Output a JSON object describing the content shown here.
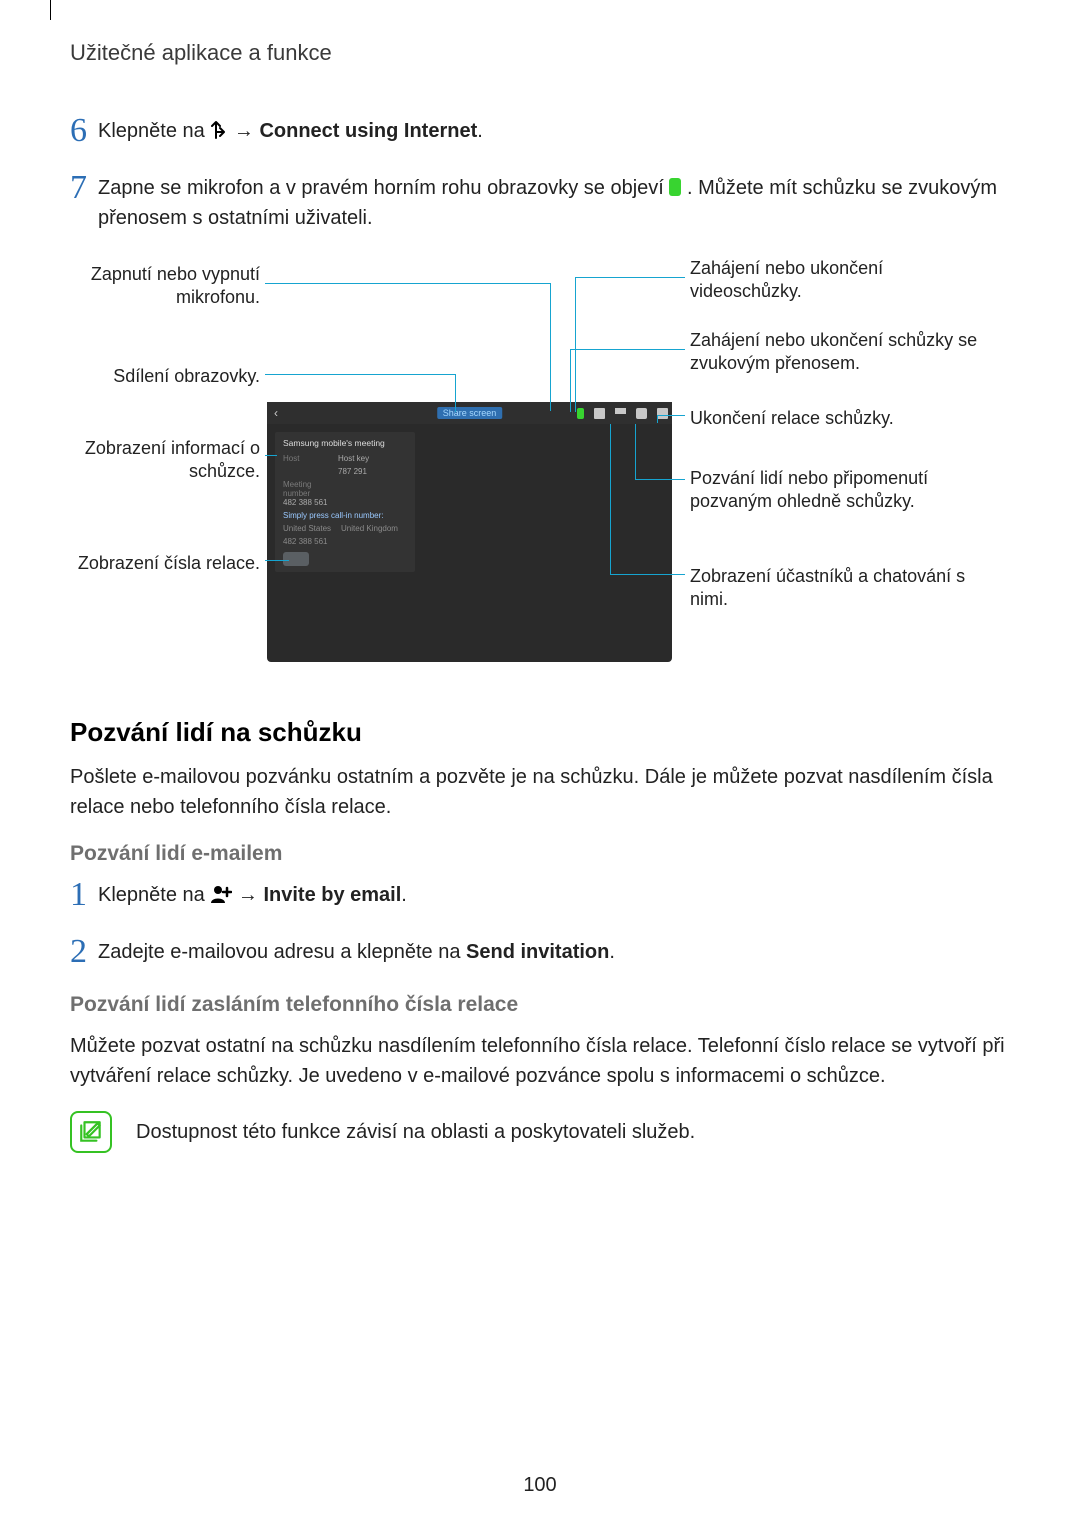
{
  "header": "Užitečné aplikace a funkce",
  "step6": {
    "prefix": "Klepněte na ",
    "arrow": "→",
    "bold": "Connect using Internet",
    "suffix": "."
  },
  "step7": {
    "line_a": "Zapne se mikrofon a v pravém horním rohu obrazovky se objeví ",
    "line_b": ". Můžete mít schůzku se zvukovým přenosem s ostatními uživateli."
  },
  "callouts": {
    "left": [
      "Zapnutí nebo vypnutí mikrofonu.",
      "Sdílení obrazovky.",
      "Zobrazení informací o schůzce.",
      "Zobrazení čísla relace."
    ],
    "right": [
      "Zahájení nebo ukončení videoschůzky.",
      "Zahájení nebo ukončení schůzky se zvukovým přenosem.",
      "Ukončení relace schůzky.",
      "Pozvání lidí nebo připomenutí pozvaným ohledně schůzky.",
      "Zobrazení účastníků a chatování s nimi."
    ]
  },
  "tablet": {
    "label": "Share screen",
    "panel_title": "Samsung mobile's meeting",
    "rows": [
      {
        "k": "Host",
        "v": "Host key"
      },
      {
        "k": "",
        "v": "787 291"
      }
    ],
    "meeting_number_label": "Meeting number",
    "meeting_number": "482 388 561",
    "join_line": "Simply press call-in number:",
    "phone_cols": [
      {
        "c1": "United States",
        "c2": "United Kingdom"
      },
      {
        "c1": "482 388 561",
        "c2": ""
      }
    ]
  },
  "section": {
    "title": "Pozvání lidí na schůzku",
    "body": "Pošlete e-mailovou pozvánku ostatním a pozvěte je na schůzku. Dále je můžete pozvat nasdílením čísla relace nebo telefonního čísla relace."
  },
  "sub1": {
    "title": "Pozvání lidí e-mailem",
    "step1_prefix": "Klepněte na ",
    "step1_arrow": "→",
    "step1_bold": "Invite by email",
    "step1_suffix": ".",
    "step2_a": "Zadejte e-mailovou adresu a klepněte na ",
    "step2_bold": "Send invitation",
    "step2_b": "."
  },
  "sub2": {
    "title": "Pozvání lidí zasláním telefonního čísla relace",
    "body": "Můžete pozvat ostatní na schůzku nasdílením telefonního čísla relace. Telefonní číslo relace se vytvoří při vytváření relace schůzky. Je uvedeno v e-mailové pozvánce spolu s informacemi o schůzce."
  },
  "note": "Dostupnost této funkce závisí na oblasti a poskytovateli služeb.",
  "page_number": "100"
}
